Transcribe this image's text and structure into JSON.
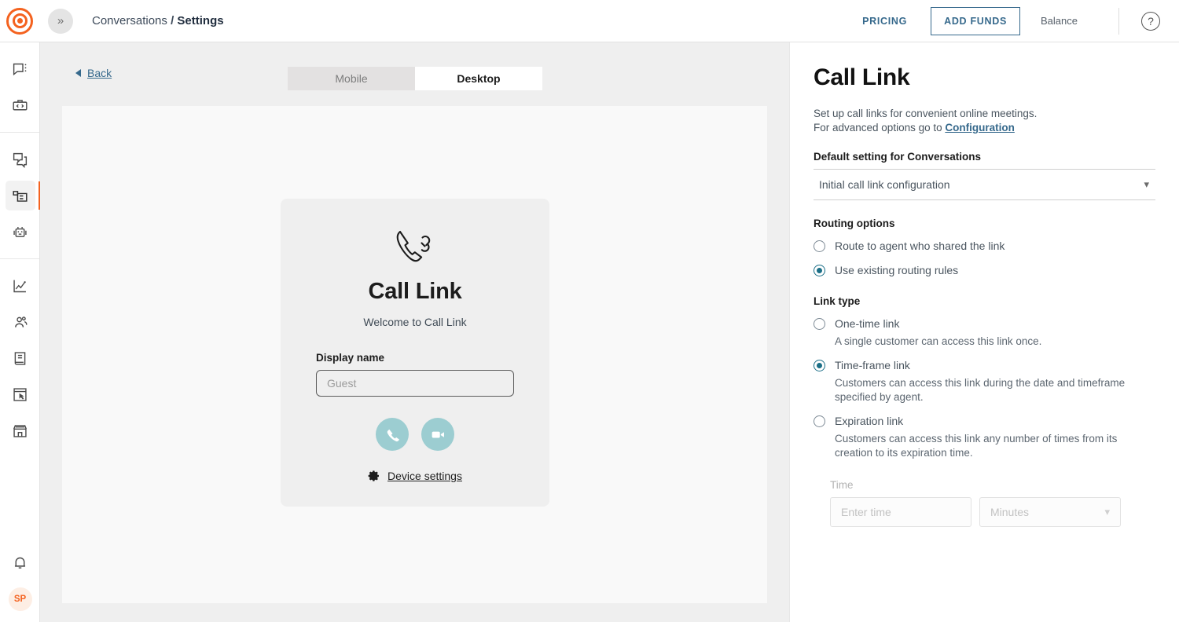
{
  "topbar": {
    "logo_icon": "target-logo-icon",
    "expand_icon": "double-chevron-right-icon",
    "breadcrumb_root": "Conversations",
    "breadcrumb_sep": "/",
    "breadcrumb_current": "Settings",
    "pricing_label": "PRICING",
    "add_funds_label": "ADD FUNDS",
    "balance_label": "Balance",
    "help_icon": "question-mark-circle-icon",
    "help_glyph": "?"
  },
  "rail": {
    "groups": [
      {
        "items": [
          {
            "name": "sidebar-item-conversations",
            "icon": "chat-bubble-menu-icon",
            "active": false
          },
          {
            "name": "sidebar-item-developer",
            "icon": "code-toolbox-icon",
            "active": false
          }
        ]
      },
      {
        "items": [
          {
            "name": "sidebar-item-copy",
            "icon": "duplicate-chat-icon",
            "active": false
          },
          {
            "name": "sidebar-item-call-link",
            "icon": "panel-minus-icon",
            "active": true
          },
          {
            "name": "sidebar-item-bots",
            "icon": "robot-icon",
            "active": false
          }
        ]
      },
      {
        "items": [
          {
            "name": "sidebar-item-analytics",
            "icon": "line-chart-icon",
            "active": false
          },
          {
            "name": "sidebar-item-contacts",
            "icon": "people-group-icon",
            "active": false
          },
          {
            "name": "sidebar-item-knowledge",
            "icon": "book-icon",
            "active": false
          },
          {
            "name": "sidebar-item-forms",
            "icon": "window-cursor-icon",
            "active": false
          },
          {
            "name": "sidebar-item-marketplace",
            "icon": "storefront-icon",
            "active": false
          }
        ]
      }
    ],
    "notifications_icon": "bell-icon",
    "avatar_initials": "SP"
  },
  "main": {
    "back_label": "Back",
    "back_icon": "triangle-left-icon",
    "tabs": [
      {
        "label": "Mobile",
        "active": false
      },
      {
        "label": "Desktop",
        "active": true
      }
    ],
    "preview": {
      "icon": "phone-link-icon",
      "title": "Call Link",
      "subtitle": "Welcome to Call Link",
      "display_name_label": "Display name",
      "display_name_value": "",
      "display_name_placeholder": "Guest",
      "audio_call_icon": "phone-icon",
      "video_call_icon": "video-camera-icon",
      "device_settings_icon": "gear-icon",
      "device_settings_label": "Device settings"
    }
  },
  "side": {
    "title": "Call Link",
    "desc_line1": "Set up call links for convenient online meetings.",
    "desc_line2_prefix": "For advanced options go to ",
    "desc_link": "Configuration",
    "default_setting_label": "Default setting for Conversations",
    "default_setting_value": "Initial call link configuration",
    "select_chevron_icon": "chevron-down-icon",
    "routing_options_label": "Routing options",
    "routing_options": [
      {
        "label": "Route to agent who shared the link",
        "checked": false
      },
      {
        "label": "Use existing routing rules",
        "checked": true
      }
    ],
    "link_type_label": "Link type",
    "link_types": [
      {
        "label": "One-time link",
        "desc": "A single customer can access this link once.",
        "checked": false
      },
      {
        "label": "Time-frame link",
        "desc": "Customers can access this link during the date and timeframe specified by agent.",
        "checked": true
      },
      {
        "label": "Expiration link",
        "desc": "Customers can access this link any number of times from its creation to its expiration time.",
        "checked": false
      }
    ],
    "time_label": "Time",
    "time_value": "",
    "time_placeholder": "Enter time",
    "time_unit_value": "Minutes"
  },
  "colors": {
    "brand_orange": "#f4621f",
    "link_blue": "#36698c",
    "teal_button": "#9ccdd1",
    "radio_selected": "#1b6f87"
  }
}
